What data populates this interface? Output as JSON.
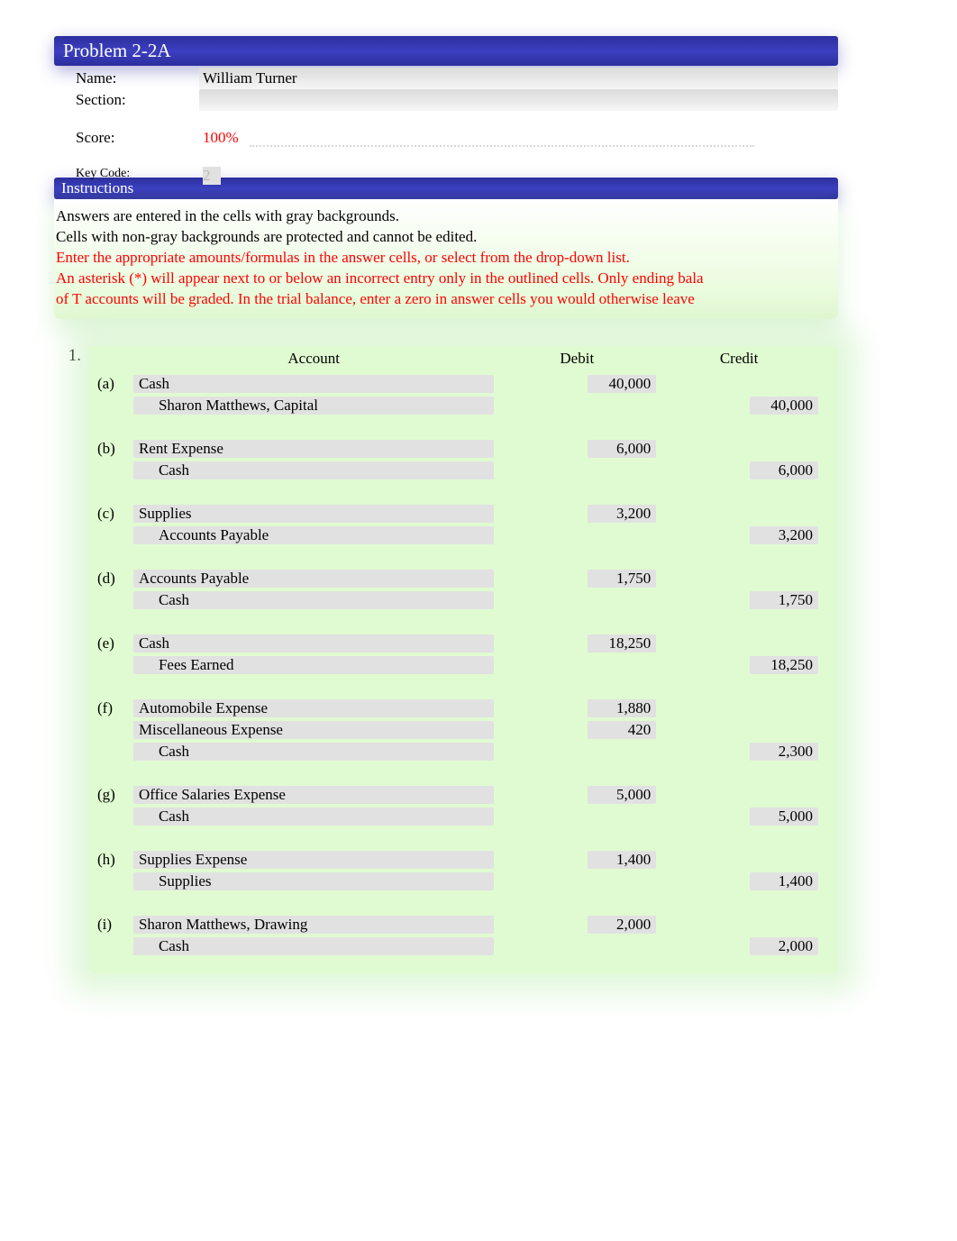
{
  "header": {
    "title": "Problem 2-2A"
  },
  "info": {
    "name_label": "Name:",
    "name_value": "William Turner",
    "section_label": "Section:",
    "section_value": "",
    "score_label": "Score:",
    "score_value": "100%",
    "keycode_label": "Key Code:",
    "keycode_value": "2"
  },
  "instructions": {
    "title": "Instructions",
    "line1": "Answers are entered in the cells with gray backgrounds.",
    "line2": "Cells with non-gray backgrounds are protected and cannot be edited.",
    "line3": "Enter the appropriate amounts/formulas in the answer cells, or select from the drop-down list.",
    "line4": "An asterisk (*) will appear next to or below an incorrect entry only in the outlined cells. Only ending bala",
    "line5": "of T accounts will be graded. In the trial balance, enter a zero in answer cells you would otherwise leave"
  },
  "question_number": "1.",
  "journal": {
    "col_account": "Account",
    "col_debit": "Debit",
    "col_credit": "Credit",
    "entries": [
      {
        "letter": "(a)",
        "lines": [
          {
            "account": "Cash",
            "debit": "40,000",
            "credit": "",
            "indent": false
          },
          {
            "account": "Sharon Matthews, Capital",
            "debit": "",
            "credit": "40,000",
            "indent": true
          }
        ]
      },
      {
        "letter": "(b)",
        "lines": [
          {
            "account": "Rent Expense",
            "debit": "6,000",
            "credit": "",
            "indent": false
          },
          {
            "account": "Cash",
            "debit": "",
            "credit": "6,000",
            "indent": true
          }
        ]
      },
      {
        "letter": "(c)",
        "lines": [
          {
            "account": "Supplies",
            "debit": "3,200",
            "credit": "",
            "indent": false
          },
          {
            "account": "Accounts Payable",
            "debit": "",
            "credit": "3,200",
            "indent": true
          }
        ]
      },
      {
        "letter": "(d)",
        "lines": [
          {
            "account": "Accounts Payable",
            "debit": "1,750",
            "credit": "",
            "indent": false
          },
          {
            "account": "Cash",
            "debit": "",
            "credit": "1,750",
            "indent": true
          }
        ]
      },
      {
        "letter": "(e)",
        "lines": [
          {
            "account": "Cash",
            "debit": "18,250",
            "credit": "",
            "indent": false
          },
          {
            "account": "Fees Earned",
            "debit": "",
            "credit": "18,250",
            "indent": true
          }
        ]
      },
      {
        "letter": "(f)",
        "lines": [
          {
            "account": "Automobile Expense",
            "debit": "1,880",
            "credit": "",
            "indent": false
          },
          {
            "account": "Miscellaneous Expense",
            "debit": "420",
            "credit": "",
            "indent": false
          },
          {
            "account": "Cash",
            "debit": "",
            "credit": "2,300",
            "indent": true
          }
        ]
      },
      {
        "letter": "(g)",
        "lines": [
          {
            "account": "Office Salaries Expense",
            "debit": "5,000",
            "credit": "",
            "indent": false
          },
          {
            "account": "Cash",
            "debit": "",
            "credit": "5,000",
            "indent": true
          }
        ]
      },
      {
        "letter": "(h)",
        "lines": [
          {
            "account": "Supplies Expense",
            "debit": "1,400",
            "credit": "",
            "indent": false
          },
          {
            "account": "Supplies",
            "debit": "",
            "credit": "1,400",
            "indent": true
          }
        ]
      },
      {
        "letter": "(i)",
        "lines": [
          {
            "account": "Sharon Matthews, Drawing",
            "debit": "2,000",
            "credit": "",
            "indent": false
          },
          {
            "account": "Cash",
            "debit": "",
            "credit": "2,000",
            "indent": true
          }
        ]
      }
    ]
  }
}
